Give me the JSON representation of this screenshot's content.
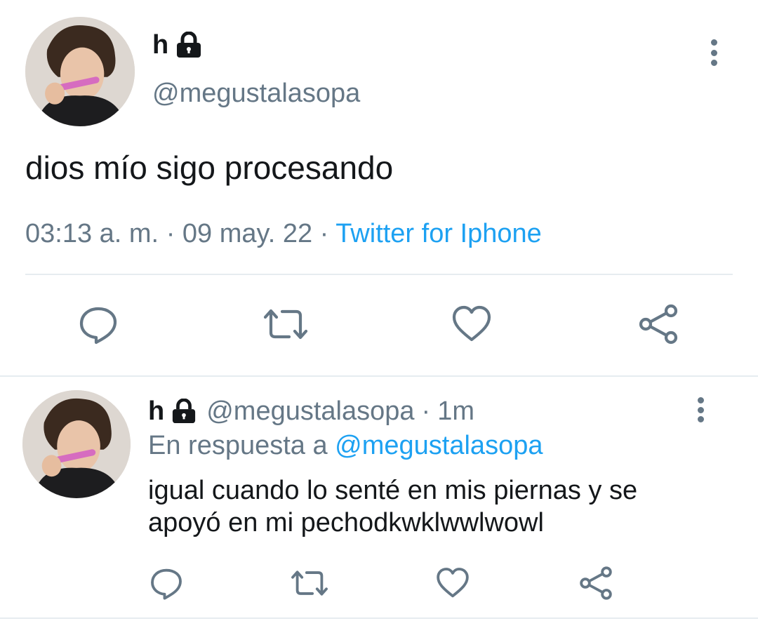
{
  "main_tweet": {
    "name": "h",
    "handle": "@megustalasopa",
    "text": "dios mío sigo procesando",
    "time": "03:13 a. m.",
    "sep1": "·",
    "date": "09 may. 22",
    "sep2": "·",
    "source": "Twitter for Iphone",
    "avatar_icon": "profile-photo",
    "lock_icon": "lock-icon"
  },
  "reply": {
    "name": "h",
    "handle": "@megustalasopa",
    "sep": "·",
    "age": "1m",
    "reply_prefix": "En respuesta a",
    "reply_to": "@megustalasopa",
    "text_line1": "igual cuando lo senté en mis piernas y se",
    "text_line2": "apoyó en mi pechodkwklwwlwowl"
  },
  "actions": [
    "reply-icon",
    "retweet-icon",
    "like-icon",
    "share-icon"
  ],
  "colors": {
    "text": "#14171a",
    "muted": "#657786",
    "link": "#1da1f2",
    "divider": "#e6ecf0"
  }
}
